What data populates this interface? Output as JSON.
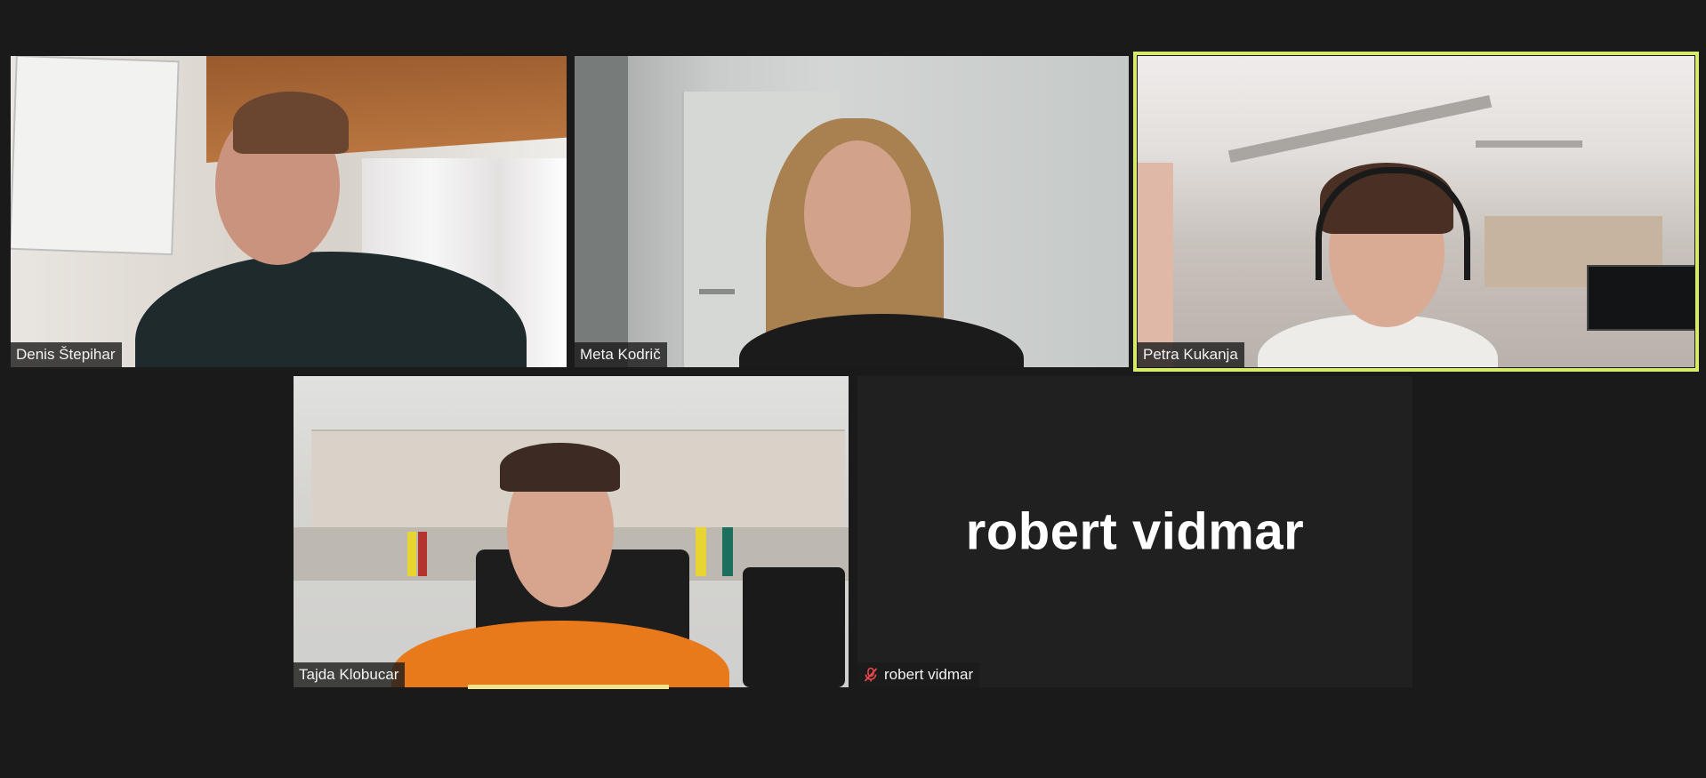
{
  "participants": [
    {
      "name": "Denis Štepihar",
      "video": true
    },
    {
      "name": "Meta Kodrič",
      "video": true
    },
    {
      "name": "Petra Kukanja",
      "video": true,
      "active_speaker": true
    },
    {
      "name": "Tajda Klobucar",
      "video": true
    },
    {
      "name": "robert vidmar",
      "video": false,
      "muted": true,
      "display_name": "robert vidmar"
    }
  ],
  "colors": {
    "background": "#1a1a1a",
    "active_speaker_border": "#d8ea6e",
    "muted_icon": "#e5484d"
  },
  "icons": {
    "muted": "muted-mic-icon"
  }
}
